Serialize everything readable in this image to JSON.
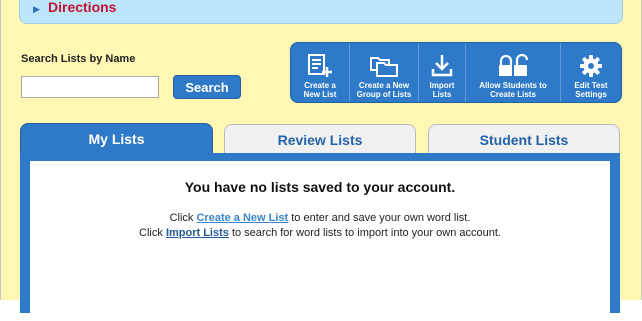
{
  "directions": {
    "label": "Directions"
  },
  "search": {
    "label": "Search Lists by Name",
    "placeholder": "",
    "value": "",
    "button": "Search"
  },
  "toolbar": {
    "items": [
      {
        "label": "Create a\nNew List",
        "icon": "create-list-icon"
      },
      {
        "label": "Create a New\nGroup of Lists",
        "icon": "folders-icon"
      },
      {
        "label": "Import\nLists",
        "icon": "download-icon"
      },
      {
        "label": "Allow Students to\nCreate Lists",
        "icon": "unlock-icon"
      },
      {
        "label": "Edit Test\nSettings",
        "icon": "gear-icon"
      }
    ]
  },
  "tabs": {
    "my_lists": "My Lists",
    "review_lists": "Review Lists",
    "student_lists": "Student Lists"
  },
  "content": {
    "empty_title": "You have no lists saved to your account.",
    "line1_pre": "Click ",
    "line1_link": "Create a New List",
    "line1_post": " to enter and save your own word list.",
    "line2_pre": "Click ",
    "line2_link": "Import Lists",
    "line2_post": " to search for word lists to import into your own account."
  },
  "colors": {
    "accent": "#2f7ac8",
    "background": "#fef8b4",
    "directions_bg": "#bde6fa",
    "directions_text": "#c3122e",
    "link": "#3b86cf"
  }
}
